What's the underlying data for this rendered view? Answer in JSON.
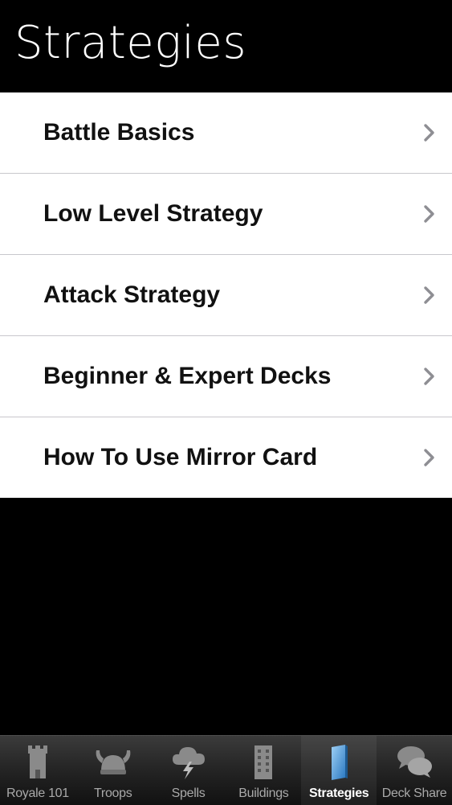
{
  "header": {
    "title": "Strategies"
  },
  "menu": {
    "items": [
      {
        "label": "Battle Basics"
      },
      {
        "label": "Low Level Strategy"
      },
      {
        "label": "Attack Strategy"
      },
      {
        "label": "Beginner & Expert Decks"
      },
      {
        "label": "How To Use Mirror Card"
      }
    ],
    "chevron_icon": "chevron-right-icon"
  },
  "tabbar": {
    "active": "Strategies",
    "tabs": [
      {
        "label": "Royale 101",
        "icon": "tower-icon"
      },
      {
        "label": "Troops",
        "icon": "viking-helmet-icon"
      },
      {
        "label": "Spells",
        "icon": "lightning-cloud-icon"
      },
      {
        "label": "Buildings",
        "icon": "building-icon"
      },
      {
        "label": "Strategies",
        "icon": "book-icon"
      },
      {
        "label": "Deck Share",
        "icon": "chat-bubbles-icon"
      }
    ]
  },
  "colors": {
    "header_bg": "#000000",
    "list_bg": "#ffffff",
    "text": "#111111",
    "chevron": "#8e8e93",
    "tab_active": "#ffffff",
    "tab_inactive": "#a9a9a9",
    "tab_active_icon": "#4a9ad6"
  }
}
